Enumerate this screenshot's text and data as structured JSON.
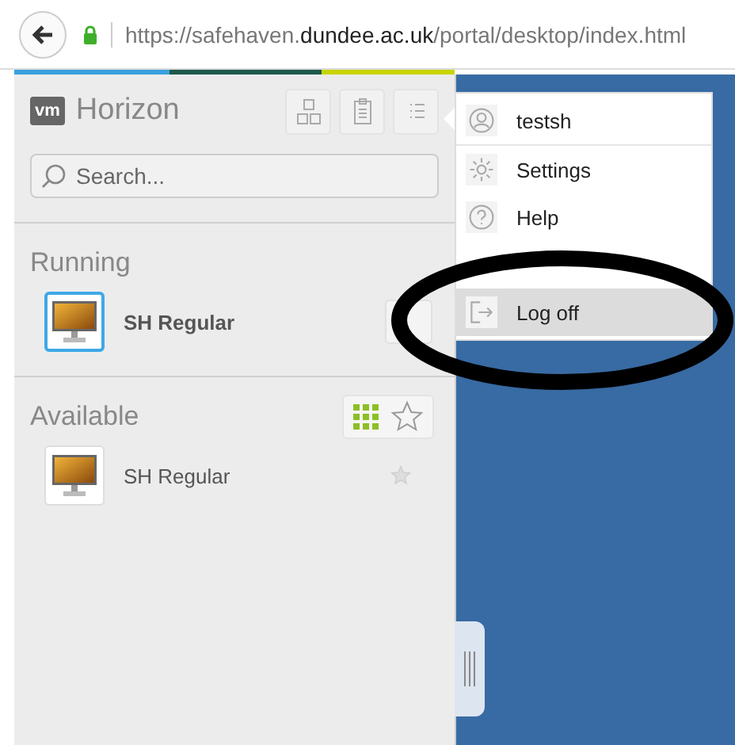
{
  "browser": {
    "url_parts": [
      {
        "text": "https://safehaven.",
        "kind": "subdomain"
      },
      {
        "text": "dundee.ac.uk",
        "kind": "domain"
      },
      {
        "text": "/portal/desktop/index.html",
        "kind": "path"
      }
    ]
  },
  "sidebar": {
    "brand": {
      "logo": "vm",
      "name": "Horizon"
    },
    "toolbar": [
      {
        "kind": "apps"
      },
      {
        "kind": "clipboard"
      },
      {
        "kind": "menu"
      }
    ],
    "search": {
      "placeholder": "Search..."
    },
    "sections": [
      {
        "title": "Running",
        "view_toggle": false,
        "items": [
          {
            "name": "SH Regular",
            "running": true
          }
        ]
      },
      {
        "title": "Available",
        "view_toggle": true,
        "items": [
          {
            "name": "SH Regular",
            "running": false
          }
        ]
      }
    ]
  },
  "user_menu": {
    "items": [
      {
        "kind": "user",
        "label": "testsh",
        "selected": false
      },
      {
        "kind": "settings",
        "label": "Settings",
        "selected": false
      },
      {
        "kind": "help",
        "label": "Help",
        "selected": false
      },
      {
        "kind": "covered"
      },
      {
        "kind": "logoff",
        "label": "Log off",
        "selected": true
      }
    ]
  }
}
